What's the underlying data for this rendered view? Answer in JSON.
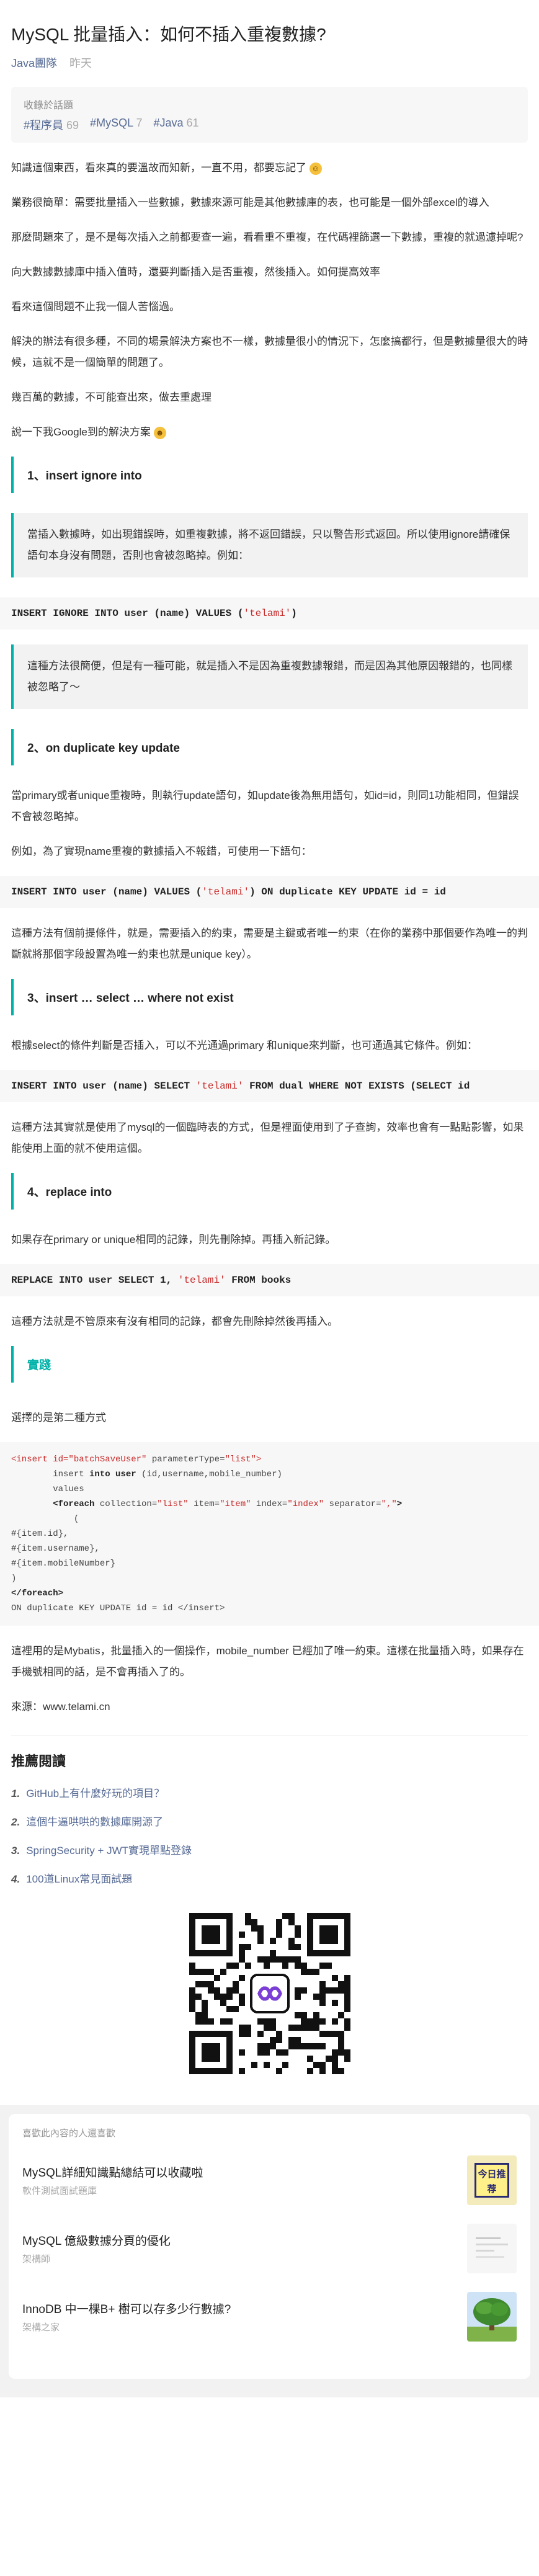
{
  "article": {
    "title": "MySQL 批量插入：如何不插入重複數據?",
    "author": "Java團隊",
    "date": "昨天"
  },
  "collection": {
    "label": "收錄於話題",
    "tags": [
      {
        "name": "#程序員",
        "count": "69"
      },
      {
        "name": "#MySQL",
        "count": "7"
      },
      {
        "name": "#Java",
        "count": "61"
      }
    ]
  },
  "content": {
    "p1": "知識這個東西，看來真的要溫故而知新，一直不用，都要忘記了",
    "p2": "業務很簡單：需要批量插入一些數據，數據來源可能是其他數據庫的表，也可能是一個外部excel的導入",
    "p3": "那麼問題來了，是不是每次插入之前都要查一遍，看看重不重複，在代碼裡篩選一下數據，重複的就過濾掉呢?",
    "p4": "向大數據數據庫中插入值時，還要判斷插入是否重複，然後插入。如何提高效率",
    "p5": "看來這個問題不止我一個人苦惱過。",
    "p6": "解決的辦法有很多種，不同的場景解決方案也不一樣，數據量很小的情況下，怎麼搞都行，但是數據量很大的時候，這就不是一個簡單的問題了。",
    "p7": "幾百萬的數據，不可能查出來，做去重處理",
    "p8": "說一下我Google到的解決方案",
    "h1": "1、insert ignore into",
    "q1": "當插入數據時，如出現錯誤時，如重複數據，將不返回錯誤，只以警告形式返回。所以使用ignore請確保語句本身沒有問題，否則也會被忽略掉。例如：",
    "code1_pre": "INSERT IGNORE INTO user (name) VALUES (",
    "code1_str": "'telami'",
    "code1_post": ")",
    "q2": "這種方法很簡便，但是有一種可能，就是插入不是因為重複數據報錯，而是因為其他原因報錯的，也同樣被忽略了～",
    "h2": "2、on duplicate key update",
    "p9": "當primary或者unique重複時，則執行update語句，如update後為無用語句，如id=id，則同1功能相同，但錯誤不會被忽略掉。",
    "p10": "例如，為了實現name重複的數據插入不報錯，可使用一下語句：",
    "code2_pre": "INSERT INTO user (name) VALUES (",
    "code2_str": "'telami'",
    "code2_post": ") ON duplicate KEY UPDATE id = id",
    "p11": "這種方法有個前提條件，就是，需要插入的約束，需要是主鍵或者唯一約束（在你的業務中那個要作為唯一的判斷就將那個字段設置為唯一約束也就是unique key）。",
    "h3": "3、insert … select … where not exist",
    "p12": "根據select的條件判斷是否插入，可以不光通過primary 和unique來判斷，也可通過其它條件。例如：",
    "code3_pre": "INSERT INTO user (name) SELECT ",
    "code3_str": "'telami'",
    "code3_post": " FROM dual WHERE NOT EXISTS (SELECT id",
    "p13": "這種方法其實就是使用了mysql的一個臨時表的方式，但是裡面使用到了子查詢，效率也會有一點點影響，如果能使用上面的就不使用這個。",
    "h4": "4、replace into",
    "p14": "如果存在primary or unique相同的記錄，則先刪除掉。再插入新記錄。",
    "code4_pre": "REPLACE INTO user SELECT 1, ",
    "code4_str": "'telami'",
    "code4_post": " FROM books",
    "p15": "這種方法就是不管原來有沒有相同的記錄，都會先刪除掉然後再插入。",
    "ack": "實踐",
    "p16": "選擇的是第二種方式",
    "mb1a": "<insert id=",
    "mb1b": "\"batchSaveUser\"",
    "mb1c": " parameterType=",
    "mb1d": "\"list\"",
    "mb1e": ">",
    "mb2a": "        insert ",
    "mb2b": "into user",
    "mb2c": " (id,username,mobile_number)",
    "mb3": "        values",
    "mb4a": "        <foreach",
    "mb4b": " collection=",
    "mb4c": "\"list\"",
    "mb4d": " item=",
    "mb4e": "\"item\"",
    "mb4f": " index=",
    "mb4g": "\"index\"",
    "mb4h": " separator=",
    "mb4i": "\",\"",
    "mb4j": ">",
    "mb5": "            (",
    "mb6": "#{item.id},",
    "mb7": "#{item.username},",
    "mb8": "#{item.mobileNumber}",
    "mb9": ")",
    "mb10": "</foreach>",
    "mb11": "ON duplicate KEY UPDATE id = id </insert>",
    "p17": "這裡用的是Mybatis，批量插入的一個操作，mobile_number 已經加了唯一約束。這樣在批量插入時，如果存在手機號相同的話，是不會再插入了的。",
    "source": "來源：www.telami.cn"
  },
  "recommend": {
    "title": "推薦閱讀",
    "items": [
      {
        "num": "1.",
        "text": "GitHub上有什麼好玩的項目？"
      },
      {
        "num": "2.",
        "text": "這個牛逼哄哄的數據庫開源了"
      },
      {
        "num": "3.",
        "text": "SpringSecurity + JWT實現單點登錄"
      },
      {
        "num": "4.",
        "text": "100道Linux常見面試題"
      }
    ]
  },
  "footer": {
    "head": "喜歡此內容的人還喜歡",
    "items": [
      {
        "title": "MySQL詳細知識點總結可以收藏啦",
        "sub": "軟件測試面試題庫",
        "thumb": "今日推荐"
      },
      {
        "title": "MySQL 億級數據分頁的優化",
        "sub": "架構師",
        "thumb": ""
      },
      {
        "title": "InnoDB 中一棵B+ 樹可以存多少行數據?",
        "sub": "架構之家",
        "thumb": ""
      }
    ]
  },
  "colors": {
    "accent": "#00b2a9",
    "link": "#576b95",
    "string": "#c92b2b"
  }
}
